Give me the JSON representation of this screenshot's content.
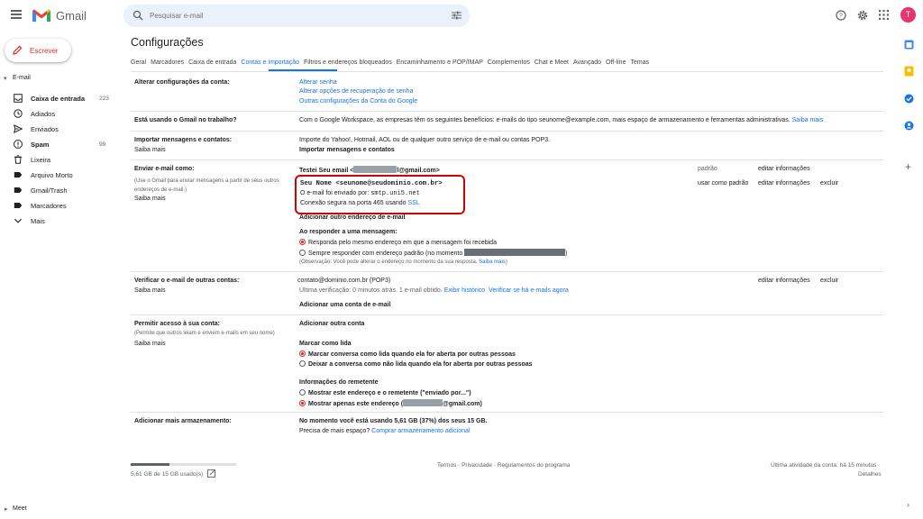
{
  "header": {
    "logo_text": "Gmail",
    "search_placeholder": "Pesquisar e-mail",
    "avatar_letter": "T"
  },
  "sidebar": {
    "compose_label": "Escrever",
    "section_email": "E-mail",
    "items": [
      {
        "label": "Caixa de entrada",
        "count": "223",
        "bold": true,
        "icon": "inbox-icon"
      },
      {
        "label": "Adiados",
        "count": "",
        "bold": false,
        "icon": "clock-icon"
      },
      {
        "label": "Enviados",
        "count": "",
        "bold": false,
        "icon": "send-icon"
      },
      {
        "label": "Spam",
        "count": "99",
        "bold": true,
        "icon": "spam-icon"
      },
      {
        "label": "Lixeira",
        "count": "",
        "bold": false,
        "icon": "trash-icon"
      },
      {
        "label": "Arquivo Morto",
        "count": "",
        "bold": false,
        "icon": "label-icon"
      },
      {
        "label": "Gmail/Trash",
        "count": "",
        "bold": false,
        "icon": "label-icon"
      },
      {
        "label": "Marcadores",
        "count": "",
        "bold": false,
        "icon": "label-icon"
      },
      {
        "label": "Mais",
        "count": "",
        "bold": false,
        "icon": "chevron-down-icon"
      }
    ],
    "meet_label": "Meet"
  },
  "main": {
    "title": "Configurações",
    "tabs": [
      {
        "label": "Geral",
        "active": false
      },
      {
        "label": "Marcadores",
        "active": false
      },
      {
        "label": "Caixa de entrada",
        "active": false
      },
      {
        "label": "Contas e importação",
        "active": true
      },
      {
        "label": "Filtros e endereços bloqueados",
        "active": false
      },
      {
        "label": "Encaminhamento e POP/IMAP",
        "active": false
      },
      {
        "label": "Complementos",
        "active": false
      },
      {
        "label": "Chat e Meet",
        "active": false
      },
      {
        "label": "Avançado",
        "active": false
      },
      {
        "label": "Off-line",
        "active": false
      },
      {
        "label": "Temas",
        "active": false
      }
    ],
    "sec_change": {
      "label": "Alterar configurações da conta:",
      "links": [
        "Alterar senha",
        "Alterar opções de recuperação de senha",
        "Outras configurações da Conta do Google"
      ]
    },
    "sec_work": {
      "label": "Está usando o Gmail no trabalho?",
      "text": "Com o Google Workspace, as empresas têm os seguintes benefícios: e-mails do tipo seunome@example.com, mais espaço de armazenamento e ferramentas administrativas.",
      "link": "Saiba mais"
    },
    "sec_import": {
      "label": "Importar mensagens e contatos:",
      "learn": "Saiba mais",
      "text": "Importe do Yahoo!, Hotmail, AOL ou de qualquer outro serviço de e-mail ou contas POP3.",
      "action": "Importar mensagens e contatos"
    },
    "sec_send": {
      "label": "Enviar e-mail como:",
      "sub": "(Use o Gmail para enviar mensagens a partir de seus outros endereços de e-mail.)",
      "learn": "Saiba mais",
      "acc1_prefix": "Testei Seu email <",
      "acc1_suffix": "l@gmail.com>",
      "acc1_default": "padrão",
      "acc1_edit": "editar informações",
      "acc2_name": "Seu Nome <seunome@seudominio.com.br>",
      "acc2_via_prefix": "O e-mail foi enviado por: ",
      "acc2_via_host": "smtp.uni5.net",
      "acc2_secure_prefix": "Conexão segura na porta 465 usando ",
      "acc2_secure_link": "SSL",
      "acc2_make_default": "usar como padrão",
      "acc2_edit": "editar informações",
      "acc2_delete": "excluir",
      "add_other": "Adicionar outro endereço de e-mail",
      "reply_title": "Ao responder a uma mensagem:",
      "reply_opt1": "Responda pelo mesmo endereço em que a mensagem foi recebida",
      "reply_opt2": "Sempre responder com endereço padrão (no momento",
      "reply_opt2_end": ")",
      "note": "(Observação: Você pode alterar o endereço no momento da sua resposta.",
      "note_link": "Saiba mais",
      "note_end": ")"
    },
    "sec_check": {
      "label": "Verificar o e-mail de outras contas:",
      "learn": "Saiba mais",
      "account": "contato@dominio.com.br (POP3)",
      "last_check": "Última verificação: 0 minutos atrás. 1 e-mail obtido.",
      "history": "Exibir histórico",
      "check_now": "Verificar se há e-mails agora",
      "edit": "editar informações",
      "delete": "excluir",
      "add": "Adicionar uma conta de e-mail"
    },
    "sec_grant": {
      "label": "Permitir acesso à sua conta:",
      "sub": "(Permite que outros leiam e enviem e-mails em seu nome)",
      "learn": "Saiba mais",
      "add": "Adicionar outra conta",
      "mark_title": "Marcar como lida",
      "mark_opt1": "Marcar conversa como lida quando ela for aberta por outras pessoas",
      "mark_opt2": "Deixar a conversa como não lida quando ela for aberta por outras pessoas",
      "sender_title": "Informações do remetente",
      "sender_opt1": "Mostrar este endereço e o remetente (\"enviado por...\")",
      "sender_opt2_prefix": "Mostrar apenas este endereço (",
      "sender_opt2_suffix": "@gmail.com)"
    },
    "sec_storage": {
      "label": "Adicionar mais armazenamento:",
      "text": "No momento você está usando 5,61 GB (37%) dos seus 15 GB.",
      "need_prefix": "Precisa de mais espaço?",
      "need_link": "Comprar armazenamento adicional"
    }
  },
  "footer": {
    "usage": "5,61 GB de 15 GB usado(s)",
    "usage_fraction": 0.37,
    "links": "Termos · Privacidade · Regulamentos do programa",
    "activity": "Última atividade da conta: há 15 minutos",
    "details": "Detalhes"
  }
}
